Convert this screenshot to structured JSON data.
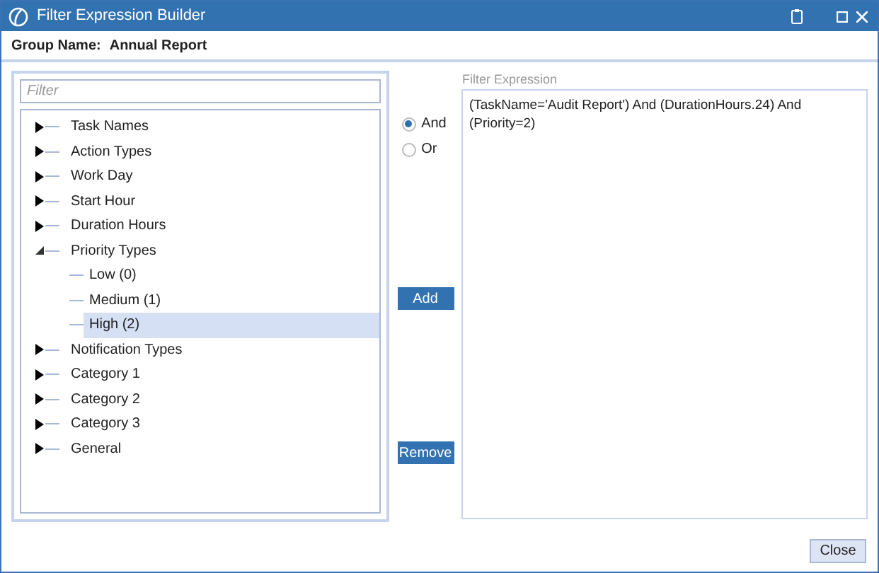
{
  "window": {
    "title": "Filter Expression Builder"
  },
  "group_name": {
    "label": "Group Name:",
    "value": "Annual Report"
  },
  "filter": {
    "placeholder": "Filter"
  },
  "tree": [
    {
      "label": "Task Names",
      "expanded": false,
      "selected": false
    },
    {
      "label": "Action Types",
      "expanded": false,
      "selected": false
    },
    {
      "label": "Work Day",
      "expanded": false,
      "selected": false
    },
    {
      "label": "Start Hour",
      "expanded": false,
      "selected": false
    },
    {
      "label": "Duration Hours",
      "expanded": false,
      "selected": false
    },
    {
      "label": "Priority Types",
      "expanded": true,
      "selected": false,
      "children": [
        {
          "label": "Low (0)",
          "selected": false
        },
        {
          "label": "Medium (1)",
          "selected": false
        },
        {
          "label": "High (2)",
          "selected": true
        }
      ]
    },
    {
      "label": "Notification Types",
      "expanded": false,
      "selected": false
    },
    {
      "label": "Category 1",
      "expanded": false,
      "selected": false
    },
    {
      "label": "Category 2",
      "expanded": false,
      "selected": false
    },
    {
      "label": "Category 3",
      "expanded": false,
      "selected": false
    },
    {
      "label": "General",
      "expanded": false,
      "selected": false
    }
  ],
  "operators": [
    {
      "label": "And",
      "selected": true
    },
    {
      "label": "Or",
      "selected": false
    }
  ],
  "buttons": {
    "add": "Add",
    "remove": "Remove",
    "close": "Close"
  },
  "expression": {
    "label": "Filter Expression",
    "value": "(TaskName='Audit Report') And (DurationHours.24) And (Priority=2)"
  }
}
